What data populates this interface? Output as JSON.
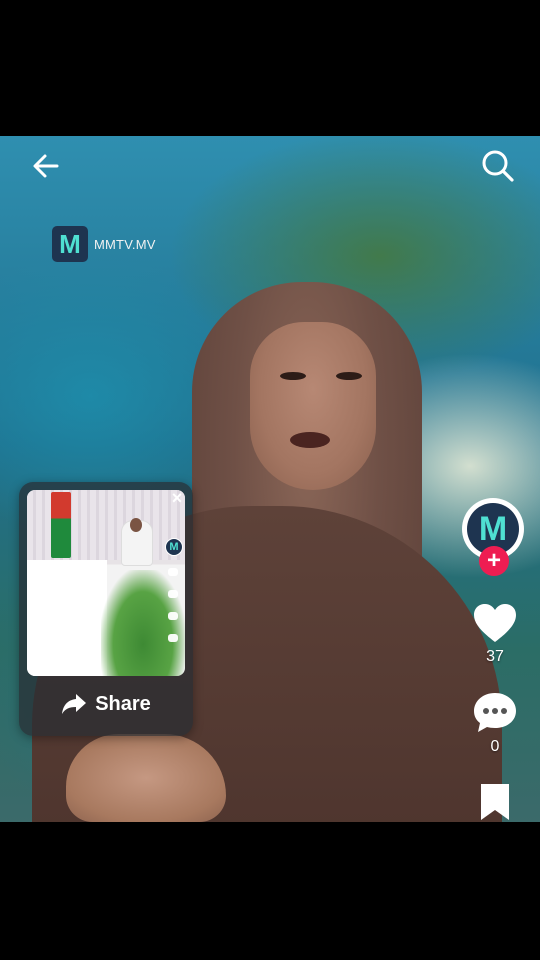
{
  "watermark": {
    "logo_letter": "M",
    "channel": "MMTV.MV"
  },
  "rail": {
    "avatar_letter": "M",
    "follow_symbol": "+",
    "likes": "37",
    "comments": "0"
  },
  "share_popup": {
    "close_symbol": "×",
    "share_label": "Share",
    "thumb_avatar_letter": "M"
  },
  "colors": {
    "accent_red": "#ee1d52",
    "brand_teal": "#4fe0d2",
    "brand_navy": "#1e3450"
  },
  "icons": [
    "back-arrow-icon",
    "search-icon",
    "heart-icon",
    "comment-icon",
    "bookmark-icon",
    "share-arrow-icon",
    "close-icon"
  ]
}
